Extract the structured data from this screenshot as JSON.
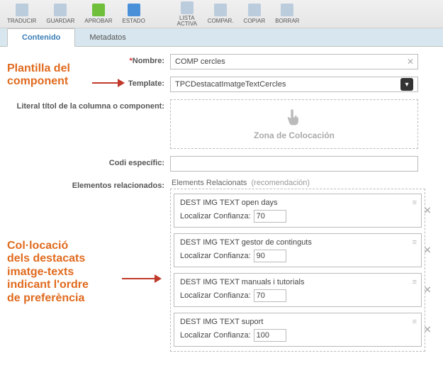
{
  "toolbar": {
    "traducir": "TRADUCIR",
    "guardar": "GUARDAR",
    "aprobar": "APROBAR",
    "estado": "ESTADO",
    "lista_activa": "LISTA\nACTIVA",
    "compar": "COMPAR.",
    "copiar": "COPIAR",
    "borrar": "BORRAR"
  },
  "tabs": {
    "contenido": "Contenido",
    "metadatos": "Metadatos"
  },
  "form": {
    "nombre_label": "Nombre:",
    "nombre_value": "COMP cercles",
    "template_label": "Template:",
    "template_value": "TPCDestacatImatgeTextCercles",
    "literal_label": "Literal títol de la columna o component:",
    "dropzone_text": "Zona de Colocación",
    "codi_label": "Codi específic:",
    "codi_value": "",
    "related_label": "Elementos relacionados:",
    "related_head": "Elements Relacionats",
    "related_rec": "(recomendación)",
    "conf_label": "Localizar Confianza:"
  },
  "related": [
    {
      "title": "DEST IMG TEXT open days",
      "confidence": "70"
    },
    {
      "title": "DEST IMG TEXT gestor de continguts",
      "confidence": "90"
    },
    {
      "title": "DEST IMG TEXT manuals i tutorials",
      "confidence": "70"
    },
    {
      "title": "DEST IMG TEXT suport",
      "confidence": "100"
    }
  ],
  "annotations": {
    "top": "Plantilla del\ncomponent",
    "bottom": "Col·locació\ndels destacats\nimatge-texts\nindicant l'ordre\nde preferència"
  }
}
